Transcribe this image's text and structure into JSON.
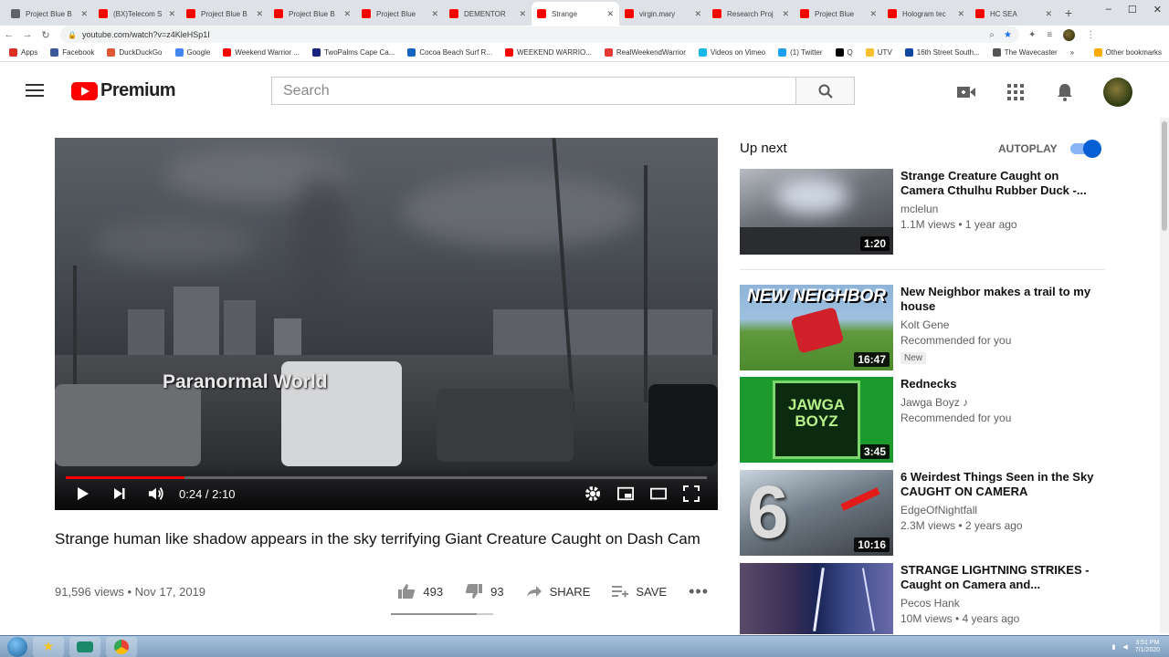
{
  "browser": {
    "tabs": [
      {
        "title": "Project Blue B",
        "color": "#5f6368"
      },
      {
        "title": "(BX)Telecom S",
        "color": "#ff0000"
      },
      {
        "title": "Project Blue B",
        "color": "#ff0000"
      },
      {
        "title": "Project Blue B",
        "color": "#ff0000"
      },
      {
        "title": "Project Blue",
        "color": "#ff0000"
      },
      {
        "title": "DEMENTOR",
        "color": "#ff0000"
      },
      {
        "title": "Strange",
        "color": "#ff0000",
        "active": true
      },
      {
        "title": "virgin.mary",
        "color": "#ff0000"
      },
      {
        "title": "Research Proj",
        "color": "#ff0000"
      },
      {
        "title": "Project Blue",
        "color": "#ff0000"
      },
      {
        "title": "Hologram tec",
        "color": "#ff0000"
      },
      {
        "title": "HC SEA",
        "color": "#ff0000"
      }
    ],
    "url": "youtube.com/watch?v=z4KleHSp1I",
    "bookmarks": [
      {
        "label": "Apps",
        "color": "#d93025"
      },
      {
        "label": "Facebook",
        "color": "#3b5998"
      },
      {
        "label": "DuckDuckGo",
        "color": "#de5833"
      },
      {
        "label": "Google",
        "color": "#4285f4"
      },
      {
        "label": "Weekend Warrior ...",
        "color": "#ff0000"
      },
      {
        "label": "TwoPalms Cape Ca...",
        "color": "#1a237e"
      },
      {
        "label": "Cocoa Beach Surf R...",
        "color": "#1565c0"
      },
      {
        "label": "WEEKEND WARRIO...",
        "color": "#ff0000"
      },
      {
        "label": "RealWeekendWarrior",
        "color": "#e53935"
      },
      {
        "label": "Videos on Vimeo",
        "color": "#1ab7ea"
      },
      {
        "label": "(1) Twitter",
        "color": "#1da1f2"
      },
      {
        "label": "Q",
        "color": "#000000"
      },
      {
        "label": "UTV",
        "color": "#fbc02d"
      },
      {
        "label": "16th Street South...",
        "color": "#0d47a1"
      },
      {
        "label": "The Wavecaster",
        "color": "#555555"
      }
    ],
    "bookmarks_more": "»",
    "other_bookmarks": "Other bookmarks"
  },
  "header": {
    "logo_text": "Premium",
    "search_placeholder": "Search"
  },
  "player": {
    "watermark": "Paranormal World",
    "time": "0:24 / 2:10",
    "progress": 0.185
  },
  "video": {
    "title": "Strange human like shadow appears in the sky terrifying Giant Creature Caught on Dash Cam",
    "views": "91,596 views",
    "date": "Nov 17, 2019",
    "likes": "493",
    "dislikes": "93",
    "share_label": "SHARE",
    "save_label": "SAVE",
    "like_ratio": 0.84
  },
  "sidebar": {
    "upnext_label": "Up next",
    "autoplay_label": "AUTOPLAY",
    "autoplay_on": true,
    "items": [
      {
        "title": "Strange Creature Caught on Camera Cthulhu Rubber Duck -...",
        "channel": "mclelun",
        "meta": "1.1M views • 1 year ago",
        "duration": "1:20"
      },
      {
        "title": "New Neighbor makes a trail to my house",
        "channel": "Kolt Gene",
        "meta": "Recommended for you",
        "badge": "New",
        "duration": "16:47",
        "thumb_text": "NEW NEIGHBOR"
      },
      {
        "title": "Rednecks",
        "channel": "Jawga Boyz ♪",
        "meta": "Recommended for you",
        "duration": "3:45",
        "thumb_text": "JAWGA BOYZ"
      },
      {
        "title": "6 Weirdest Things Seen in the Sky CAUGHT ON CAMERA",
        "channel": "EdgeOfNightfall",
        "meta": "2.3M views • 2 years ago",
        "duration": "10:16",
        "thumb_text": "6"
      },
      {
        "title": "STRANGE LIGHTNING STRIKES - Caught on Camera and...",
        "channel": "Pecos Hank",
        "meta": "10M views • 4 years ago",
        "duration": ""
      }
    ]
  },
  "taskbar": {
    "time": "3:51 PM",
    "date": "7/1/2020"
  }
}
